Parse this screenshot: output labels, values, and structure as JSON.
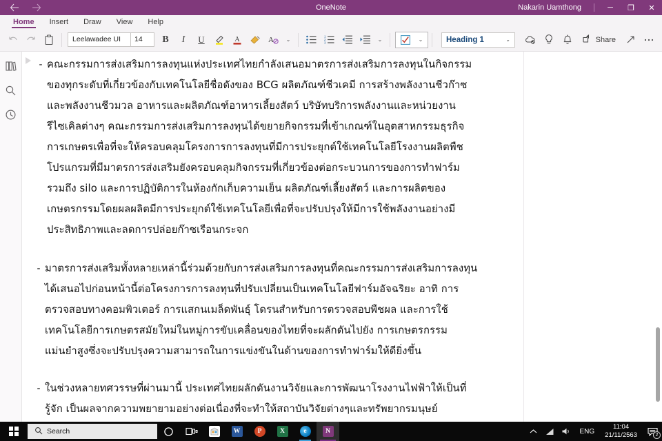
{
  "titlebar": {
    "app_title": "OneNote",
    "user": "Nakarin Uamthong",
    "back_icon": "back-arrow-icon",
    "forward_icon": "forward-arrow-icon",
    "minimize": "─",
    "maximize": "❐",
    "close": "✕"
  },
  "ribbon_tabs": [
    {
      "label": "Home",
      "active": true
    },
    {
      "label": "Insert",
      "active": false
    },
    {
      "label": "Draw",
      "active": false
    },
    {
      "label": "View",
      "active": false
    },
    {
      "label": "Help",
      "active": false
    }
  ],
  "ribbon": {
    "undo_label": "↶",
    "redo_label": "↷",
    "clipboard_icon": "paste-icon",
    "font_name": "Leelawadee UI",
    "font_size": "14",
    "bold_label": "B",
    "italic_label": "I",
    "underline_label": "U",
    "highlight_icon": "highlighter-icon",
    "font_color_label": "A",
    "format_painter_icon": "format-painter-icon",
    "clear_formatting_label": "A",
    "more_font_chevron": "⌄",
    "bullets_icon": "bulleted-list-icon",
    "numbering_icon": "numbered-list-icon",
    "decrease_indent_icon": "decrease-indent-icon",
    "increase_indent_icon": "increase-indent-icon",
    "paragraph_chevron": "⌄",
    "todo_icon": "checkbox-todo-icon",
    "todo_chevron": "⌄",
    "tags_chevron": "⌄",
    "style_label": "Heading 1",
    "style_chevron": "⌄",
    "sync_icon": "cloud-sync-icon",
    "tellme_icon": "lightbulb-icon",
    "notifications_icon": "bell-icon",
    "share_icon": "share-icon",
    "share_label": "Share",
    "expand_icon": "expand-arrow-icon",
    "more_icon": "ellipsis-icon"
  },
  "navrail": {
    "notebooks_icon": "notebooks-icon",
    "search_icon": "search-icon",
    "recent_icon": "recent-clock-icon"
  },
  "page": {
    "paragraphs": [
      {
        "marker": "-",
        "text": "คณะกรรมการส่งเสริมการลงทุนแห่งประเทศไทยกำลังเสนอมาตรการส่งเสริมการลงทุนในกิจกรรมของทุกระดับที่เกี่ยวข้องกับเทคโนโลยีชื่อดังของ BCG ผลิตภัณฑ์ชีวเคมี การสร้างพลังงานชีวก๊าซ และพลังงานชีวมวล อาหารและผลิตภัณฑ์อาหารเลี้ยงสัตว์ บริษัทบริการพลังงานและหน่วยงานรีไซเคิลต่างๆ คณะกรรมการส่งเสริมการลงทุนได้ขยายกิจกรรมที่เข้าเกณฑ์ในอุตสาหกรรมธุรกิจการเกษตรเพื่อที่จะให้ครอบคลุมโครงการการลงทุนที่มีการประยุกต์ใช้เทคโนโลยีโรงงานผลิตพืชโปรแกรมที่มีมาตรการส่งเสริมยังครอบคลุมกิจกรรมที่เกี่ยวข้องต่อกระบวนการของการทำฟาร์มรวมถึง silo และการปฏิบัติการในห้องกักเก็บความเย็น ผลิตภัณฑ์เลี้ยงสัตว์ และการผลิตของเกษตรกรรมโดยผลผลิตมีการประยุกต์ใช้เทคโนโลยีเพื่อที่จะปรับปรุงให้มีการใช้พลังงานอย่างมีประสิทธิภาพและลดการปล่อยก๊าซเรือนกระจก"
      },
      {
        "marker": "-",
        "text": "มาตรการส่งเสริมทั้งหลายเหล่านี้ร่วมด้วยกับการส่งเสริมการลงทุนที่คณะกรรมการส่งเสริมการลงทุนได้เสนอไปก่อนหน้านี้ต่อโครงการการลงทุนที่ปรับเปลี่ยนเป็นเทคโนโลยีฟาร์มอัจฉริยะ อาทิ การตรวจสอบทางคอมพิวเตอร์ การแสกนเมล็ดพันธุ์ โดรนสำหรับการตรวจสอบพืชผล และการใช้เทคโนโลยีการเกษตรสมัยใหม่ในหมู่การขับเคลื่อนของไทยที่จะผลักดันไปยัง การเกษตรกรรมแม่นยำสูงซึ่งจะปรับปรุงความสามารถในการแข่งขันในด้านของการทำฟาร์มให้ดียิ่งขึ้น"
      },
      {
        "marker": "-",
        "text": "ในช่วงหลายทศวรรษที่ผ่านมานี้ ประเทศไทยผลักดันงานวิจัยและการพัฒนาโรงงานไฟฟ้าให้เป็นที่รู้จัก เป็นผลจากความพยายามอย่างต่อเนื่องที่จะทำให้สถาบันวิจัยต่างๆและทรัพยากรมนุษย์"
      }
    ]
  },
  "taskbar": {
    "search_placeholder": "Search",
    "start_icon": "windows-start-icon",
    "search_icon": "search-icon",
    "cortana_icon": "cortana-icon",
    "taskview_icon": "task-view-icon",
    "apps": [
      {
        "name": "microsoft-store",
        "label": "☰",
        "color": "#ffffff",
        "state": ""
      },
      {
        "name": "word",
        "label": "W",
        "color": "#2b579a",
        "state": ""
      },
      {
        "name": "powerpoint",
        "label": "P",
        "color": "#d24726",
        "state": ""
      },
      {
        "name": "excel",
        "label": "X",
        "color": "#217346",
        "state": ""
      },
      {
        "name": "edge",
        "label": "e",
        "color": "#0c80c4",
        "state": "open"
      },
      {
        "name": "onenote",
        "label": "N",
        "color": "#80397B",
        "state": "active"
      }
    ],
    "tray": {
      "show_hidden_icon": "chevron-up-icon",
      "network_icon": "network-signal-icon",
      "volume_icon": "volume-icon",
      "language": "ENG",
      "time": "11:04",
      "date": "21/11/2563",
      "notifications_icon": "action-center-icon",
      "notification_count": "2"
    }
  }
}
